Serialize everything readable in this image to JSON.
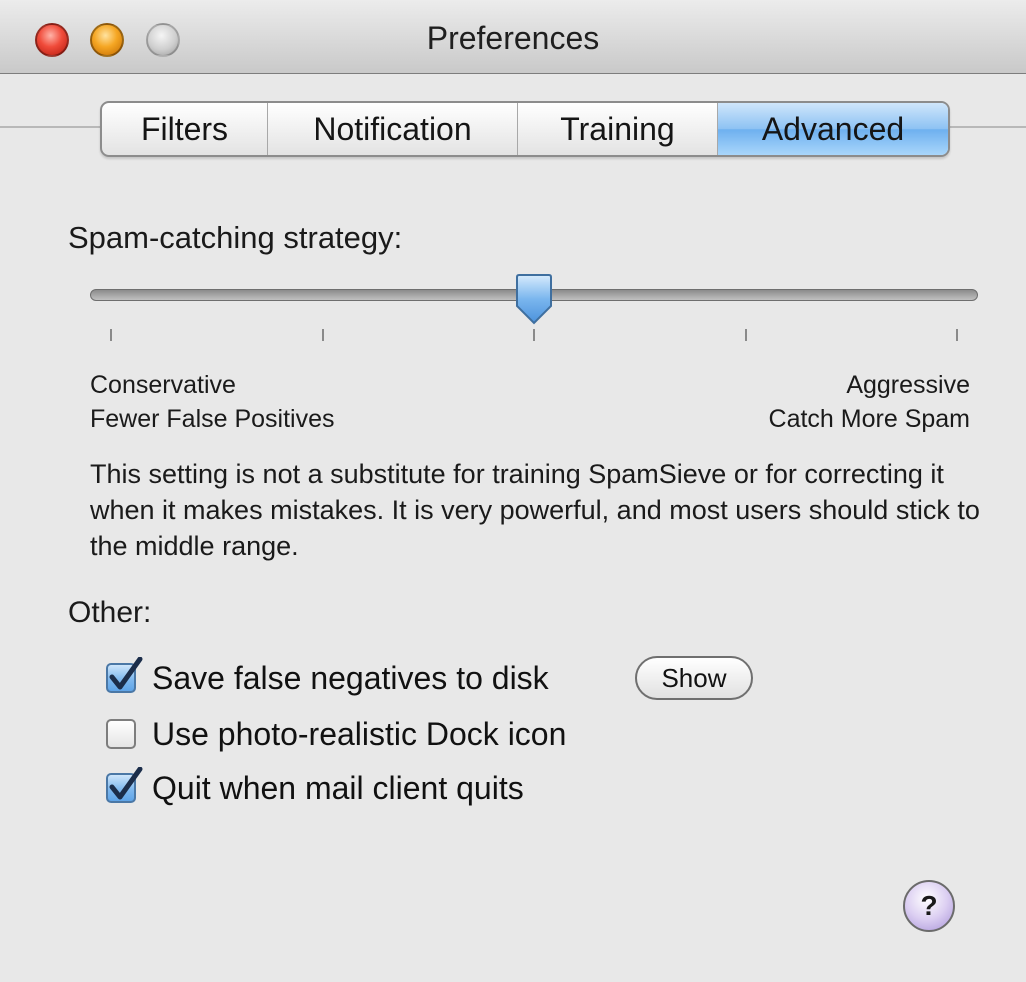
{
  "window": {
    "title": "Preferences"
  },
  "tabs": [
    {
      "label": "Filters",
      "active": false
    },
    {
      "label": "Notification",
      "active": false
    },
    {
      "label": "Training",
      "active": false
    },
    {
      "label": "Advanced",
      "active": true
    }
  ],
  "strategy": {
    "label": "Spam-catching strategy:",
    "slider_level": 0.5,
    "tick_count": 5,
    "left_title": "Conservative",
    "left_subtitle": "Fewer False Positives",
    "right_title": "Aggressive",
    "right_subtitle": "Catch More Spam",
    "note": "This setting is not a substitute for training SpamSieve or for correcting it when it makes mistakes. It is very powerful, and most users should stick to the middle range."
  },
  "other": {
    "label": "Other:",
    "options": [
      {
        "label": "Save false negatives to disk",
        "checked": true
      },
      {
        "label": "Use photo-realistic Dock icon",
        "checked": false
      },
      {
        "label": "Quit when mail client quits",
        "checked": true
      }
    ],
    "show_button": "Show"
  },
  "help": {
    "symbol": "?"
  },
  "colors": {
    "active_tab": "#8dc2f3",
    "checkbox_checked": "#5ea4e8",
    "window_bg": "#e8e8e8",
    "help_button": "#a893d8"
  },
  "icons": {
    "close": "close-light-icon",
    "minimize": "minimize-light-icon",
    "zoom": "zoom-light-icon",
    "check": "checkmark-icon",
    "help": "help-icon"
  }
}
